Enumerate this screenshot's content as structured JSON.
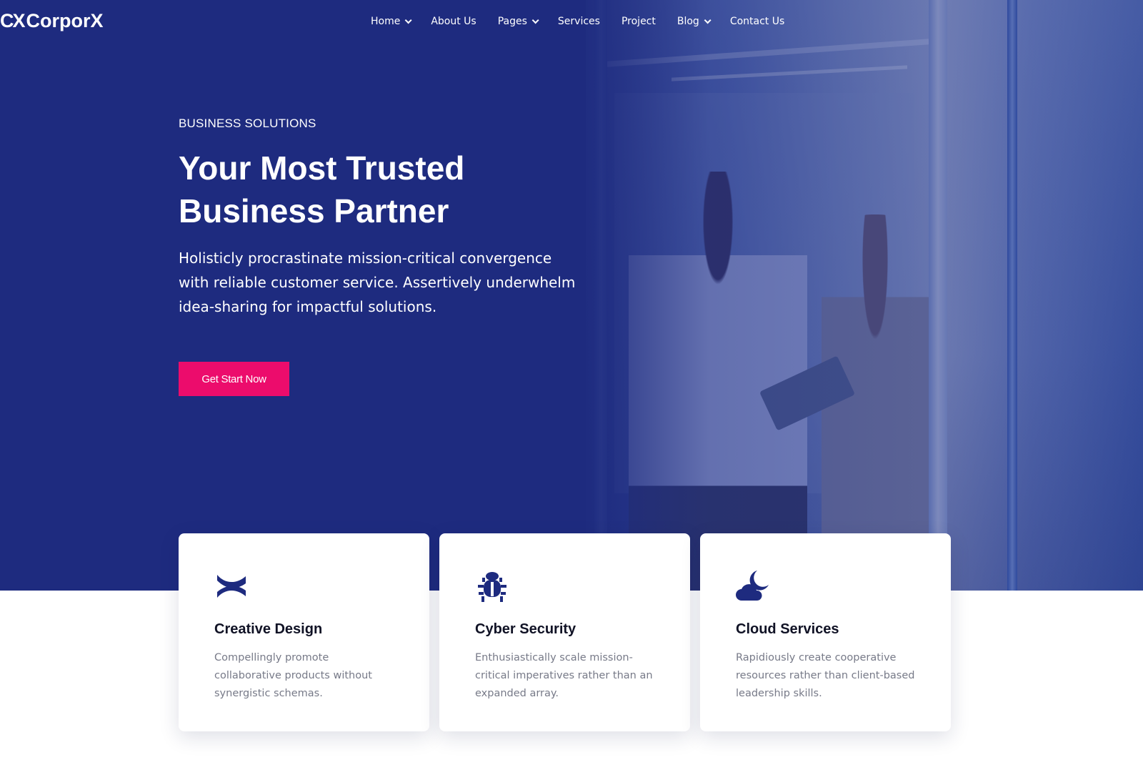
{
  "brand": {
    "logo_mark": "CX",
    "name": "CorporX"
  },
  "nav": {
    "items": [
      {
        "label": "Home",
        "dropdown": true
      },
      {
        "label": "About Us",
        "dropdown": false
      },
      {
        "label": "Pages",
        "dropdown": true
      },
      {
        "label": "Services",
        "dropdown": false
      },
      {
        "label": "Project",
        "dropdown": false
      },
      {
        "label": "Blog",
        "dropdown": true
      },
      {
        "label": "Contact Us",
        "dropdown": false
      }
    ]
  },
  "hero": {
    "eyebrow": "BUSINESS SOLUTIONS",
    "headline_line1": "Your Most Trusted",
    "headline_line2": "Business Partner",
    "description": "Holisticly procrastinate mission-critical convergence with reliable customer service. Assertively underwhelm idea-sharing for impactful solutions.",
    "cta_label": "Get Start Now"
  },
  "features": [
    {
      "icon": "confluence-icon",
      "title": "Creative Design",
      "text": "Compellingly promote collaborative products without synergistic schemas."
    },
    {
      "icon": "bug-icon",
      "title": "Cyber Security",
      "text": "Enthusiastically scale mission-critical imperatives rather than an expanded array."
    },
    {
      "icon": "cloud-moon-icon",
      "title": "Cloud Services",
      "text": "Rapidiously create cooperative resources rather than client-based leadership skills."
    }
  ],
  "colors": {
    "hero_bg": "#1e2b7f",
    "accent": "#ec0c6c",
    "icon": "#1e2b7f"
  }
}
